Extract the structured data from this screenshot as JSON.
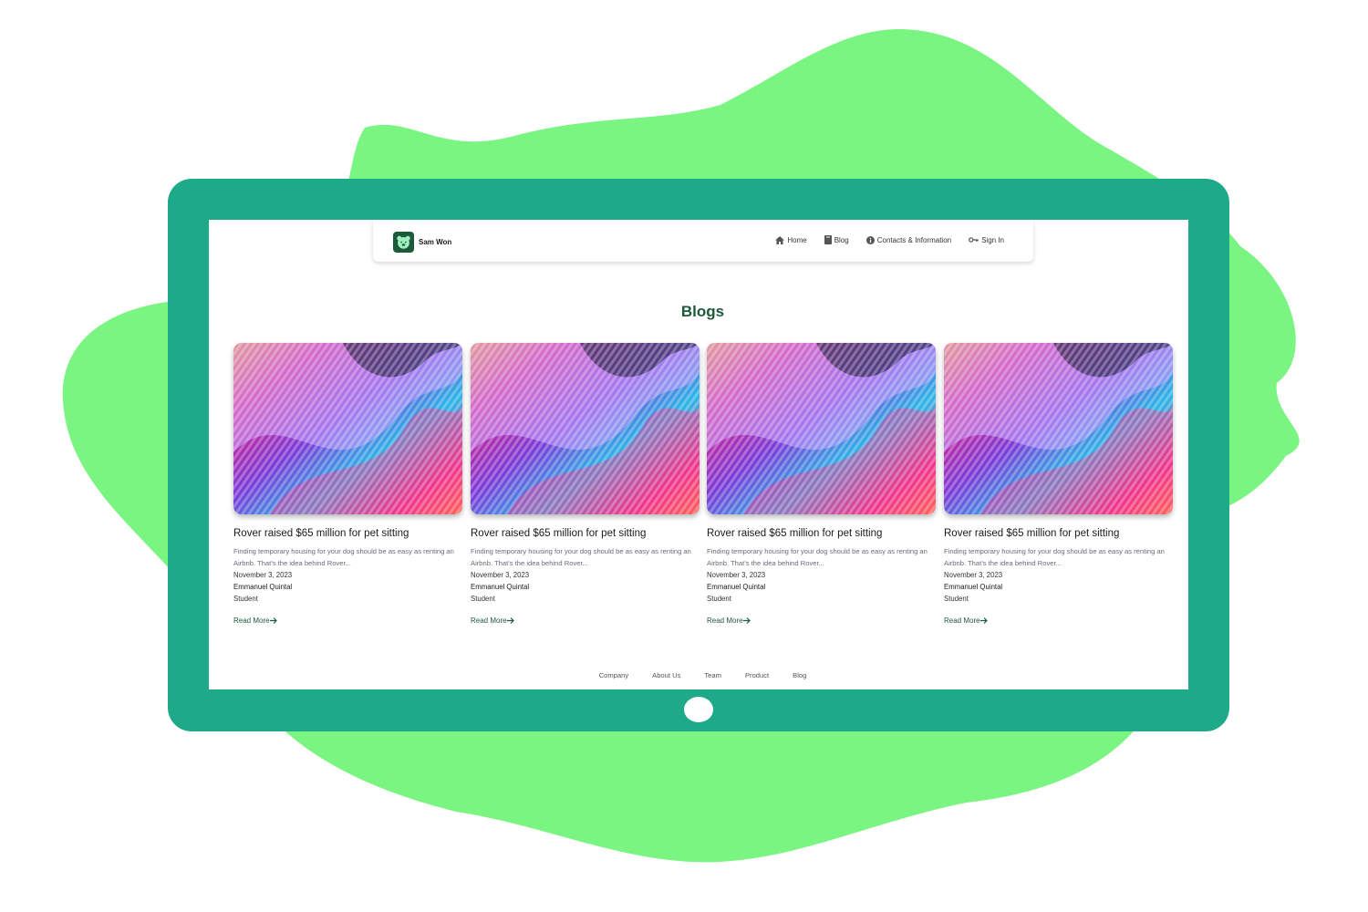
{
  "brand": {
    "name": "Sam Won"
  },
  "nav": [
    {
      "label": "Home",
      "icon": "home-icon"
    },
    {
      "label": "Blog",
      "icon": "book-icon"
    },
    {
      "label": "Contacts & Information",
      "icon": "info-icon"
    },
    {
      "label": "Sign In",
      "icon": "key-icon"
    }
  ],
  "page": {
    "title": "Blogs"
  },
  "posts": [
    {
      "title": "Rover raised $65 million for pet sitting",
      "excerpt": "Finding temporary housing for your dog should be as easy as renting an Airbnb. That’s the idea behind Rover...",
      "date": "November 3, 2023",
      "author": "Emmanuel Quintal",
      "role": "Student",
      "cta": "Read More"
    },
    {
      "title": "Rover raised $65 million for pet sitting",
      "excerpt": "Finding temporary housing for your dog should be as easy as renting an Airbnb. That’s the idea behind Rover...",
      "date": "November 3, 2023",
      "author": "Emmanuel Quintal",
      "role": "Student",
      "cta": "Read More"
    },
    {
      "title": "Rover raised $65 million for pet sitting",
      "excerpt": "Finding temporary housing for your dog should be as easy as renting an Airbnb. That’s the idea behind Rover...",
      "date": "November 3, 2023",
      "author": "Emmanuel Quintal",
      "role": "Student",
      "cta": "Read More"
    },
    {
      "title": "Rover raised $65 million for pet sitting",
      "excerpt": "Finding temporary housing for your dog should be as easy as renting an Airbnb. That’s the idea behind Rover...",
      "date": "November 3, 2023",
      "author": "Emmanuel Quintal",
      "role": "Student",
      "cta": "Read More"
    }
  ],
  "footer": [
    "Company",
    "About Us",
    "Team",
    "Product",
    "Blog"
  ],
  "colors": {
    "blob": "#7af582",
    "device": "#1eaa88",
    "brand": "#1d5a3a"
  }
}
